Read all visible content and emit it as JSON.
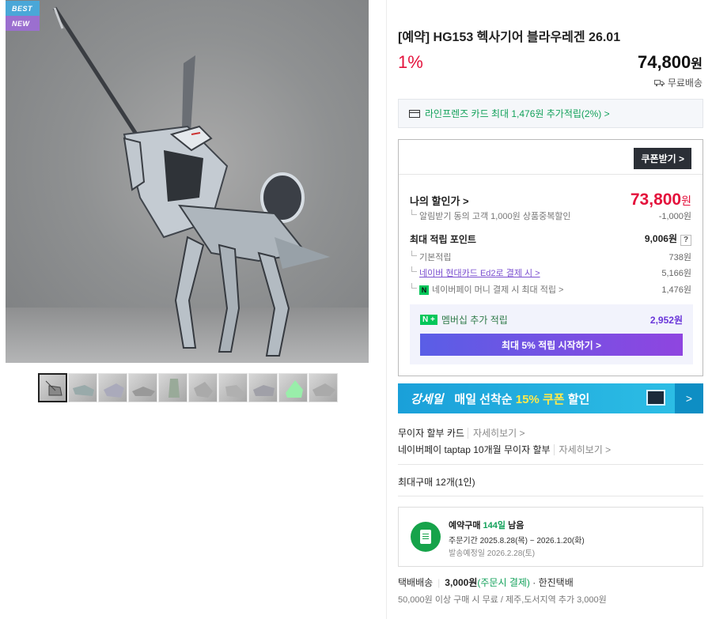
{
  "badges": {
    "best": "BEST",
    "new": "NEW"
  },
  "product": {
    "title": "[예약] HG153 헥사기어 블라우레겐 26.01",
    "discount_rate": "1%",
    "price": "74,800",
    "price_unit": "원",
    "shipping": "무료배송"
  },
  "card_banner": {
    "text": "라인프렌즈 카드 최대 1,476원 추가적립(2%) >"
  },
  "discount_box": {
    "coupon_button": "쿠폰받기 >",
    "my_price_label": "나의 할인가 >",
    "my_price": "73,800",
    "my_price_unit": "원",
    "alert_label": "알림받기 동의 고객 1,000원 상품중복할인",
    "alert_value": "-1,000원",
    "max_points_label": "최대 적립 포인트",
    "max_points_value": "9,006원",
    "help": "?",
    "basic_label": "기본적립",
    "basic_value": "738원",
    "card_link": "네이버 현대카드 Ed2로 결제 시 >",
    "card_value": "5,166원",
    "npay_label": "네이버페이 머니 결제 시 최대 적립 >",
    "npay_value": "1,476원",
    "npay_icon": "N",
    "member_badge": "N +",
    "member_label": "멤버십 추가 적립",
    "member_value": "2,952원",
    "member_button": "최대 5% 적립 시작하기 >"
  },
  "promo": {
    "logo": "강세일",
    "text_prefix": "매일 선착순 ",
    "text_highlight": "15% 쿠폰",
    "text_suffix": " 할인",
    "arrow": ">"
  },
  "installments": [
    {
      "label": "무이자 할부 카드",
      "more": "자세히보기 >"
    },
    {
      "label": "네이버페이 taptap 10개월 무이자 할부",
      "more": "자세히보기 >"
    }
  ],
  "max_purchase": "최대구매 12개(1인)",
  "preorder": {
    "title_prefix": "예약구매 ",
    "days": "144일",
    "title_suffix": " 남음",
    "order_period": "주문기간  2025.8.28(목) ~ 2026.1.20(화)",
    "ship_date": "발송예정일  2026.2.28(토)"
  },
  "delivery": {
    "label": "택배배송",
    "fee": "3,000원",
    "fee_note": "(주문시 결제)",
    "carrier": " · 한진택배",
    "sub": "50,000원 이상 구매 시 무료 / 제주,도서지역 추가 3,000원"
  },
  "colors": {
    "accent_red": "#e4123c",
    "naver_green": "#03c75a",
    "purple": "#7b4fd0",
    "promo_blue": "#1aa0d9"
  }
}
